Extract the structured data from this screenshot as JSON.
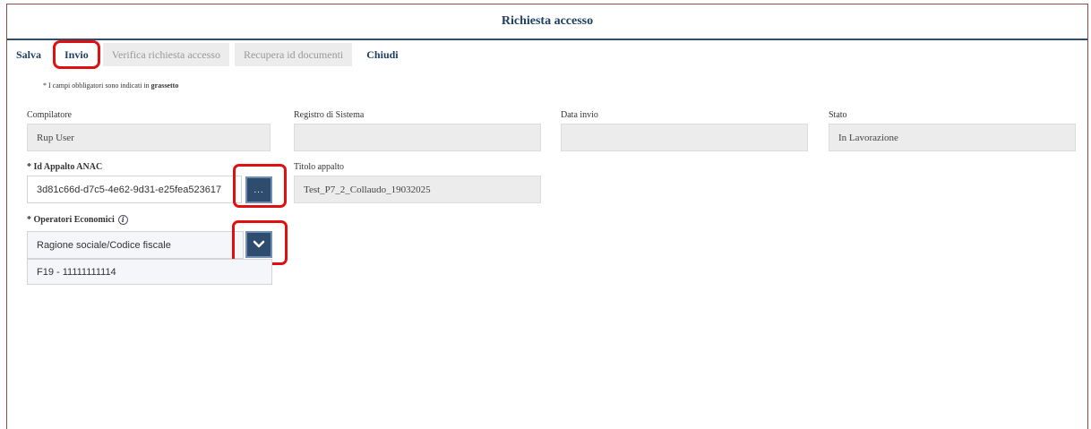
{
  "header": {
    "title": "Richiesta accesso"
  },
  "toolbar": {
    "salva": "Salva",
    "invio": "Invio",
    "verifica": "Verifica richiesta accesso",
    "recupera": "Recupera id documenti",
    "chiudi": "Chiudi"
  },
  "note": {
    "prefix": "* I campi obbligatori sono indicati in",
    "bold": "grassetto"
  },
  "fields": {
    "compilatore": {
      "label": "Compilatore",
      "value": "Rup User"
    },
    "registro": {
      "label": "Registro di Sistema",
      "value": ""
    },
    "data_invio": {
      "label": "Data invio",
      "value": ""
    },
    "stato": {
      "label": "Stato",
      "value": "In Lavorazione"
    },
    "id_appalto": {
      "label": "* Id Appalto ANAC",
      "value": "3d81c66d-d7c5-4e62-9d31-e25fea523617",
      "button": "..."
    },
    "titolo": {
      "label": "Titolo appalto",
      "value": "Test_P7_2_Collaudo_19032025"
    },
    "operatori": {
      "label": "* Operatori Economici",
      "info_icon": "info-icon",
      "placeholder": "Ragione sociale/Codice fiscale",
      "selected": "F19 - 11111111114"
    }
  },
  "icons": {
    "chevron": "chevron-down-icon"
  },
  "colors": {
    "accent": "#2e4d6e",
    "highlight": "#e01010",
    "field_bg": "#ececec"
  }
}
